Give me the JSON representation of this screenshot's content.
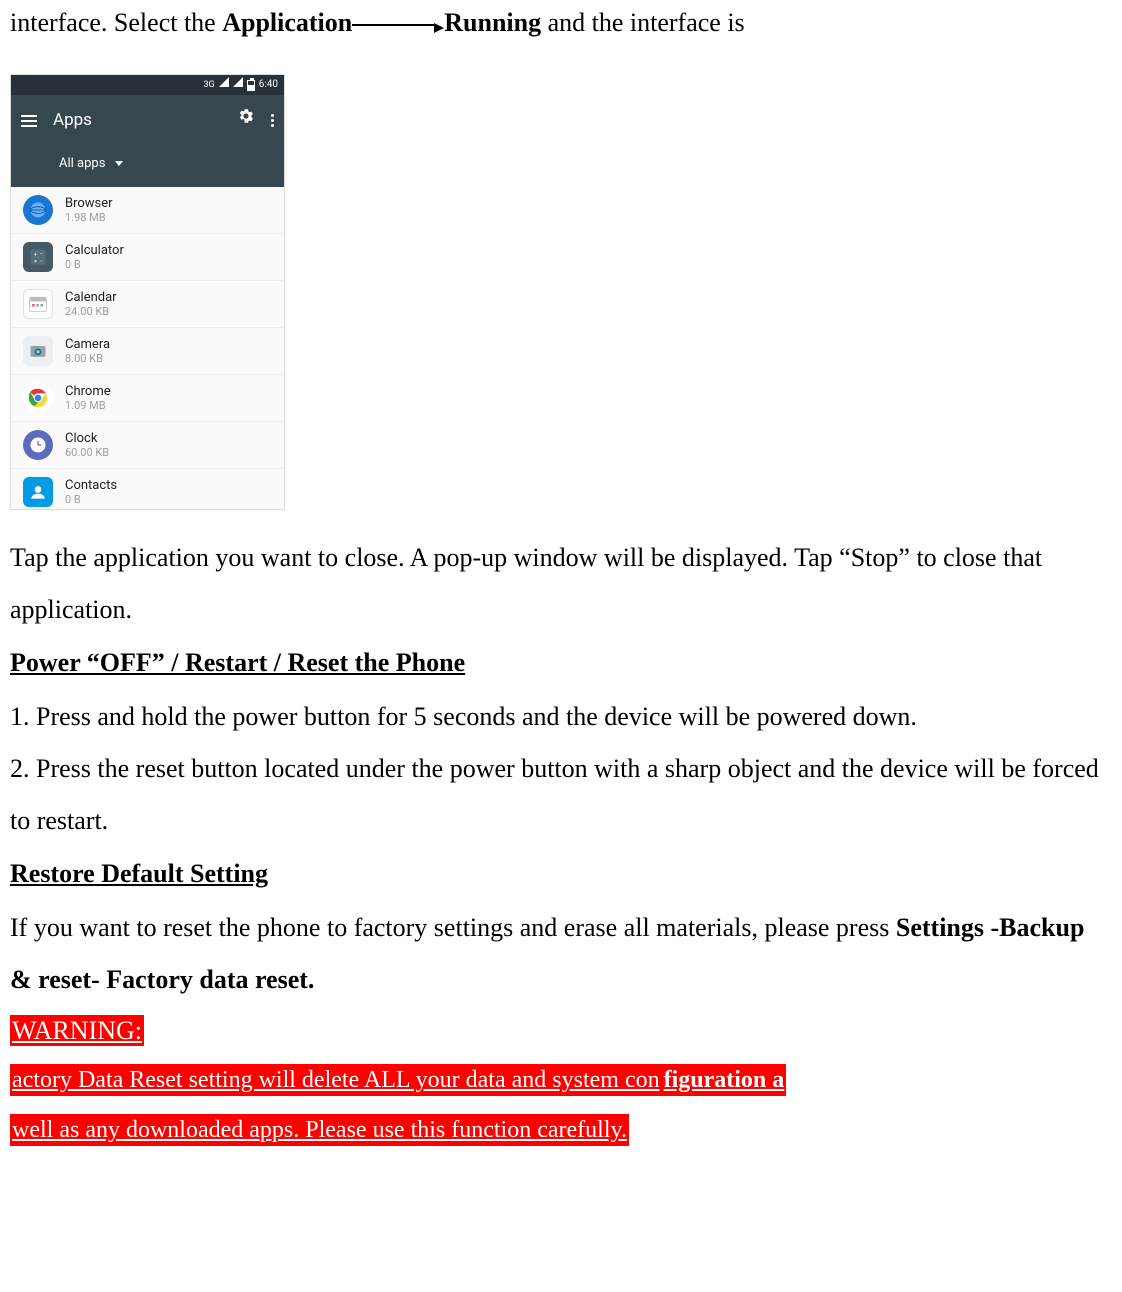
{
  "topline": {
    "prefix": "interface. Select the ",
    "app_label": "Application",
    "running_label": "Running",
    "suffix": " and the interface is"
  },
  "screenshot": {
    "status": {
      "net": "3G",
      "time": "6:40"
    },
    "title": "Apps",
    "filter": "All apps",
    "apps": [
      {
        "name": "Browser",
        "size": "1.98 MB",
        "icon": "browser"
      },
      {
        "name": "Calculator",
        "size": "0 B",
        "icon": "calculator"
      },
      {
        "name": "Calendar",
        "size": "24.00 KB",
        "icon": "calendar"
      },
      {
        "name": "Camera",
        "size": "8.00 KB",
        "icon": "camera"
      },
      {
        "name": "Chrome",
        "size": "1.09 MB",
        "icon": "chrome"
      },
      {
        "name": "Clock",
        "size": "60.00 KB",
        "icon": "clock"
      },
      {
        "name": "Contacts",
        "size": "0 B",
        "icon": "contacts"
      }
    ]
  },
  "body": {
    "tap_close": "Tap the application you want to close. A pop-up window will be displayed. Tap “Stop” to close that application.",
    "power_heading": "Power “OFF” / Restart / Reset the Phone",
    "power_step1": "1.  Press and hold the power button for 5 seconds and the device will be powered down.",
    "power_step2": "2. Press the reset button located under the power button with a sharp object and the device will be forced to restart.",
    "restore_heading": "Restore Default Setting",
    "restore_text_prefix": "If you want to reset the phone to factory settings and erase all materials, please press ",
    "restore_bold": "Settings -Backup & reset- Factory data reset."
  },
  "warning": {
    "label": "WARNING:",
    "line1_a": "actory Data Reset setting will delete ALL your data and system con",
    "line1_b": "figuration a",
    "line2": "well as any downloaded apps. Please use this function carefully."
  }
}
